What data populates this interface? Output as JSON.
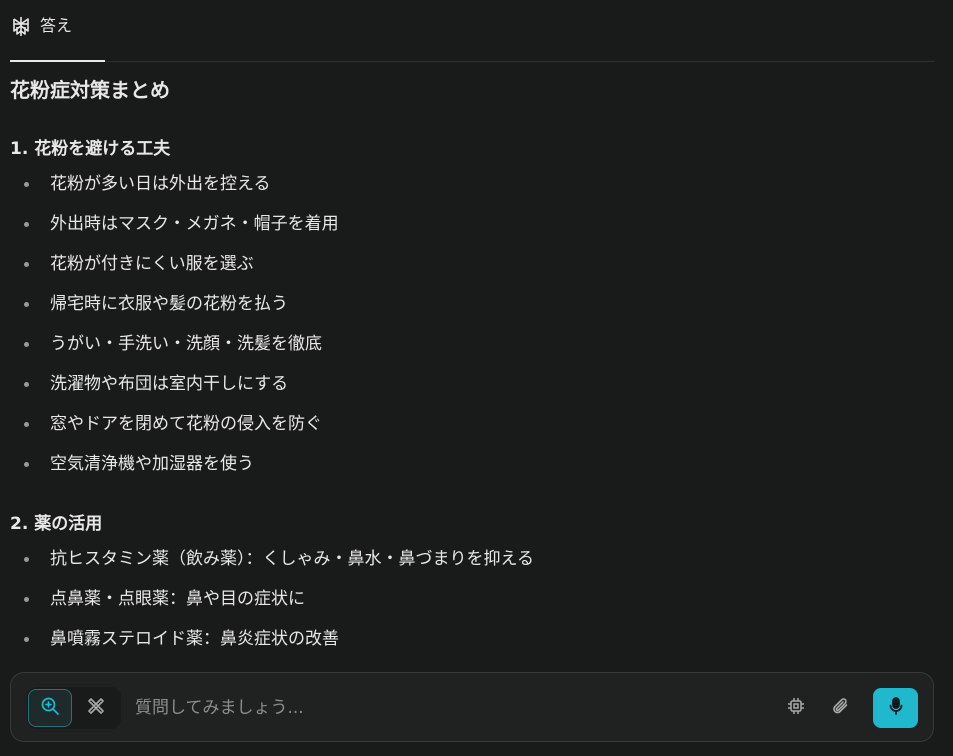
{
  "tab": {
    "label": "答え",
    "icon": "perplexity-logo-icon"
  },
  "content": {
    "title": "花粉症対策まとめ",
    "sections": [
      {
        "heading": "1. 花粉を避ける工夫",
        "items": [
          "花粉が多い日は外出を控える",
          "外出時はマスク・メガネ・帽子を着用",
          "花粉が付きにくい服を選ぶ",
          "帰宅時に衣服や髪の花粉を払う",
          "うがい・手洗い・洗顔・洗髪を徹底",
          "洗濯物や布団は室内干しにする",
          "窓やドアを閉めて花粉の侵入を防ぐ",
          "空気清浄機や加湿器を使う"
        ]
      },
      {
        "heading": "2. 薬の活用",
        "items": [
          "抗ヒスタミン薬（飲み薬）：くしゃみ・鼻水・鼻づまりを抑える",
          "点鼻薬・点眼薬：鼻や目の症状に",
          "鼻噴霧ステロイド薬：鼻炎症状の改善"
        ]
      }
    ]
  },
  "composer": {
    "placeholder": "質問してみましょう...",
    "mode_search_icon": "search-icon",
    "mode_research_icon": "research-icon",
    "chip_icon": "chip-icon",
    "attach_icon": "paperclip-icon",
    "mic_icon": "microphone-icon"
  },
  "colors": {
    "background": "#191a1a",
    "text": "#e8e8e6",
    "accent": "#20b8cd",
    "composer_bg": "#202222"
  }
}
